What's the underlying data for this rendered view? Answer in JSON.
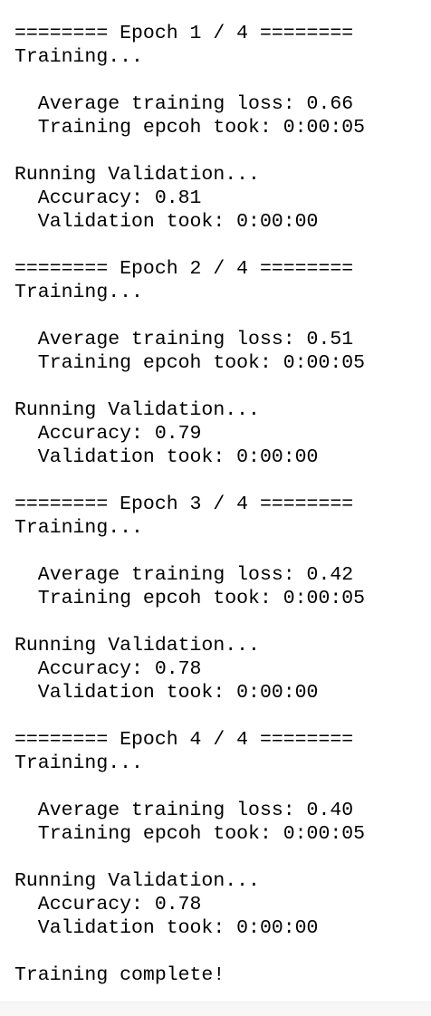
{
  "log": {
    "epochs": [
      {
        "header": "======== Epoch 1 / 4 ========",
        "training": "Training...",
        "avg_loss": "  Average training loss: 0.66",
        "epoch_time": "  Training epcoh took: 0:00:05",
        "running_validation": "Running Validation...",
        "accuracy": "  Accuracy: 0.81",
        "validation_time": "  Validation took: 0:00:00"
      },
      {
        "header": "======== Epoch 2 / 4 ========",
        "training": "Training...",
        "avg_loss": "  Average training loss: 0.51",
        "epoch_time": "  Training epcoh took: 0:00:05",
        "running_validation": "Running Validation...",
        "accuracy": "  Accuracy: 0.79",
        "validation_time": "  Validation took: 0:00:00"
      },
      {
        "header": "======== Epoch 3 / 4 ========",
        "training": "Training...",
        "avg_loss": "  Average training loss: 0.42",
        "epoch_time": "  Training epcoh took: 0:00:05",
        "running_validation": "Running Validation...",
        "accuracy": "  Accuracy: 0.78",
        "validation_time": "  Validation took: 0:00:00"
      },
      {
        "header": "======== Epoch 4 / 4 ========",
        "training": "Training...",
        "avg_loss": "  Average training loss: 0.40",
        "epoch_time": "  Training epcoh took: 0:00:05",
        "running_validation": "Running Validation...",
        "accuracy": "  Accuracy: 0.78",
        "validation_time": "  Validation took: 0:00:00"
      }
    ],
    "complete": "Training complete!"
  },
  "colors": {
    "text": "#000000",
    "background": "#ffffff",
    "bottom_strip": "#f7f7f7"
  }
}
